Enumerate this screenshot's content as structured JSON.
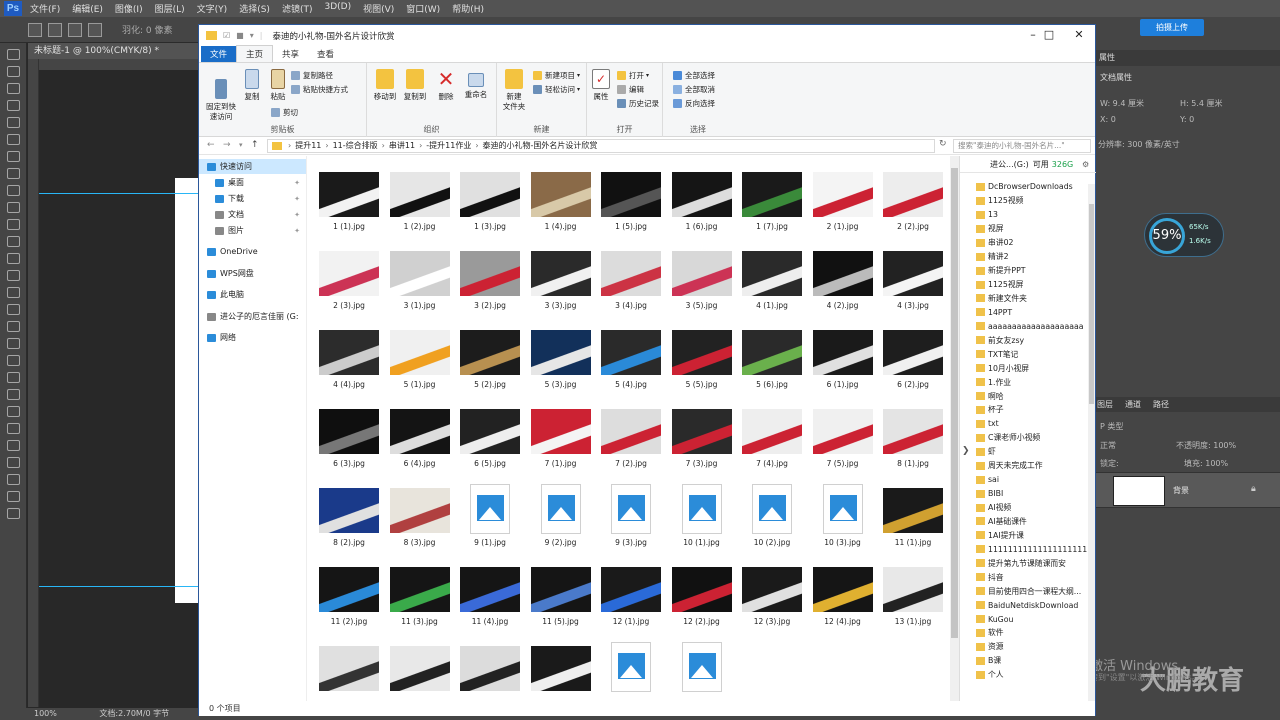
{
  "photoshop": {
    "logo": "Ps",
    "menu": [
      "文件(F)",
      "编辑(E)",
      "图像(I)",
      "图层(L)",
      "文字(Y)",
      "选择(S)",
      "滤镜(T)",
      "3D(D)",
      "视图(V)",
      "窗口(W)",
      "帮助(H)"
    ],
    "options_text": "羽化: 0 像素",
    "doc_tab": "未标题-1 @ 100%(CMYK/8) *",
    "status_zoom": "100%",
    "status_doc": "文档:2.70M/0 字节",
    "cloud_button": "拍摄上传",
    "properties_tab": "属性",
    "properties_title": "文档属性",
    "prop_w": "W: 9.4 厘米",
    "prop_h": "H: 5.4 厘米",
    "prop_x": "X: 0",
    "prop_y": "Y: 0",
    "prop_res": "分辨率: 300 像素/英寸",
    "speed_pct": "59%",
    "speed_up": "65K/s",
    "speed_down": "1.6K/s",
    "layers_tabs": [
      "图层",
      "通道",
      "路径"
    ],
    "layers_filter": "P 类型",
    "layers_mode": "正常",
    "layers_opacity": "不透明度: 100%",
    "layers_lock": "锁定:",
    "layers_fill": "填充: 100%",
    "layer_name": "背景",
    "watermark": "大鹏教育",
    "activate_line1": "激活 Windows",
    "activate_line2": "转到\"设置\"以激活 Windows。"
  },
  "explorer": {
    "title": "泰迪的小礼物-国外名片设计欣赏",
    "tabs": [
      "文件",
      "主页",
      "共享",
      "查看"
    ],
    "ribbon": {
      "pin": "固定到快\n速访问",
      "copy": "复制",
      "paste": "粘贴",
      "copy_path": "复制路径",
      "paste_shortcut": "粘贴快捷方式",
      "cut": "剪切",
      "clipboard": "剪贴板",
      "move_to": "移动到",
      "copy_to": "复制到",
      "delete": "删除",
      "rename": "重命名",
      "organize": "组织",
      "new_folder": "新建\n文件夹",
      "new_item": "新建项目",
      "easy_access": "轻松访问",
      "new": "新建",
      "properties": "属性",
      "open": "打开",
      "edit": "编辑",
      "history": "历史记录",
      "open_group": "打开",
      "select_all": "全部选择",
      "select_none": "全部取消",
      "invert": "反向选择",
      "select_group": "选择"
    },
    "breadcrumb": [
      "提升11",
      "11-综合排版",
      "串讲11",
      "-提升11作业",
      "泰迪的小礼物-国外名片设计欣赏"
    ],
    "search_placeholder": "搜索\"泰迪的小礼物-国外名片...\"",
    "nav": [
      {
        "label": "快速访问",
        "color": "#2b8cd9"
      },
      {
        "label": "桌面",
        "color": "#2b8cd9"
      },
      {
        "label": "下载",
        "color": "#2b8cd9"
      },
      {
        "label": "文档",
        "color": "#888888"
      },
      {
        "label": "图片",
        "color": "#888888"
      },
      {
        "label": "OneDrive",
        "color": "#2b8cd9"
      },
      {
        "label": "WPS网盘",
        "color": "#2b8cd9"
      },
      {
        "label": "此电脑",
        "color": "#2b8cd9"
      },
      {
        "label": "进公子的厄言佳丽 (G:",
        "color": "#888888"
      },
      {
        "label": "网络",
        "color": "#2b8cd9"
      }
    ],
    "files": [
      {
        "name": "1 (1).jpg",
        "c": "#1a1a1a",
        "c2": "#f2f2f2"
      },
      {
        "name": "1 (2).jpg",
        "c": "#e6e6e6",
        "c2": "#111111"
      },
      {
        "name": "1 (3).jpg",
        "c": "#e0e0e0",
        "c2": "#111111"
      },
      {
        "name": "1 (4).jpg",
        "c": "#8a6a48",
        "c2": "#d8c9a8"
      },
      {
        "name": "1 (5).jpg",
        "c": "#111111",
        "c2": "#555555"
      },
      {
        "name": "1 (6).jpg",
        "c": "#151515",
        "c2": "#dddddd"
      },
      {
        "name": "1 (7).jpg",
        "c": "#1a1a1a",
        "c2": "#3a8a3a"
      },
      {
        "name": "2 (1).jpg",
        "c": "#f4f4f4",
        "c2": "#cc2233"
      },
      {
        "name": "2 (2).jpg",
        "c": "#ededed",
        "c2": "#cc2233"
      },
      {
        "name": "2 (3).jpg",
        "c": "#f2f2f2",
        "c2": "#cc3355"
      },
      {
        "name": "3 (1).jpg",
        "c": "#d0d0d0",
        "c2": "#ffffff"
      },
      {
        "name": "3 (2).jpg",
        "c": "#9a9a9a",
        "c2": "#cc2233"
      },
      {
        "name": "3 (3).jpg",
        "c": "#2a2a2a",
        "c2": "#f0f0f0"
      },
      {
        "name": "3 (4).jpg",
        "c": "#dcdcdc",
        "c2": "#cc3344"
      },
      {
        "name": "3 (5).jpg",
        "c": "#d8d8d8",
        "c2": "#cc3355"
      },
      {
        "name": "4 (1).jpg",
        "c": "#2a2a2a",
        "c2": "#eeeeee"
      },
      {
        "name": "4 (2).jpg",
        "c": "#111111",
        "c2": "#bbbbbb"
      },
      {
        "name": "4 (3).jpg",
        "c": "#222222",
        "c2": "#f4f4f4"
      },
      {
        "name": "4 (4).jpg",
        "c": "#2c2c2c",
        "c2": "#cccccc"
      },
      {
        "name": "5 (1).jpg",
        "c": "#f0f0f0",
        "c2": "#f0a020"
      },
      {
        "name": "5 (2).jpg",
        "c": "#1c1c1c",
        "c2": "#b89050"
      },
      {
        "name": "5 (3).jpg",
        "c": "#12305a",
        "c2": "#e6e6e6"
      },
      {
        "name": "5 (4).jpg",
        "c": "#2a2a2a",
        "c2": "#2a8ad8"
      },
      {
        "name": "5 (5).jpg",
        "c": "#222222",
        "c2": "#cc2233"
      },
      {
        "name": "5 (6).jpg",
        "c": "#2a2a2a",
        "c2": "#6ab04c"
      },
      {
        "name": "6 (1).jpg",
        "c": "#1a1a1a",
        "c2": "#e0e0e0"
      },
      {
        "name": "6 (2).jpg",
        "c": "#1e1e1e",
        "c2": "#f0f0f0"
      },
      {
        "name": "6 (3).jpg",
        "c": "#0f0f0f",
        "c2": "#777777"
      },
      {
        "name": "6 (4).jpg",
        "c": "#141414",
        "c2": "#dddddd"
      },
      {
        "name": "6 (5).jpg",
        "c": "#222222",
        "c2": "#eeeeee"
      },
      {
        "name": "7 (1).jpg",
        "c": "#cc2233",
        "c2": "#f4f4f4"
      },
      {
        "name": "7 (2).jpg",
        "c": "#dddddd",
        "c2": "#cc2233"
      },
      {
        "name": "7 (3).jpg",
        "c": "#2a2a2a",
        "c2": "#cc2233"
      },
      {
        "name": "7 (4).jpg",
        "c": "#eeeeee",
        "c2": "#cc2233"
      },
      {
        "name": "7 (5).jpg",
        "c": "#f0f0f0",
        "c2": "#cc2233"
      },
      {
        "name": "8 (1).jpg",
        "c": "#e4e4e4",
        "c2": "#cc2233"
      },
      {
        "name": "8 (2).jpg",
        "c": "#1a3a8a",
        "c2": "#e0e0e0"
      },
      {
        "name": "8 (3).jpg",
        "c": "#e8e4dc",
        "c2": "#b04040"
      },
      {
        "name": "9 (1).jpg",
        "ph": true
      },
      {
        "name": "9 (2).jpg",
        "ph": true
      },
      {
        "name": "9 (3).jpg",
        "ph": true
      },
      {
        "name": "10 (1).jpg",
        "ph": true
      },
      {
        "name": "10 (2).jpg",
        "ph": true
      },
      {
        "name": "10 (3).jpg",
        "ph": true
      },
      {
        "name": "11 (1).jpg",
        "c": "#1a1a1a",
        "c2": "#d0a030"
      },
      {
        "name": "11 (2).jpg",
        "c": "#151515",
        "c2": "#2a8ad8"
      },
      {
        "name": "11 (3).jpg",
        "c": "#151515",
        "c2": "#3aaa4a"
      },
      {
        "name": "11 (4).jpg",
        "c": "#151515",
        "c2": "#3a6ad8"
      },
      {
        "name": "11 (5).jpg",
        "c": "#151515",
        "c2": "#4a7aca"
      },
      {
        "name": "12 (1).jpg",
        "c": "#1a1a1a",
        "c2": "#2a6ad8"
      },
      {
        "name": "12 (2).jpg",
        "c": "#111111",
        "c2": "#cc2233"
      },
      {
        "name": "12 (3).jpg",
        "c": "#1a1a1a",
        "c2": "#e0e0e0"
      },
      {
        "name": "12 (4).jpg",
        "c": "#151515",
        "c2": "#e0b030"
      },
      {
        "name": "13 (1).jpg",
        "c": "#e8e8e8",
        "c2": "#222222"
      },
      {
        "name": "",
        "c": "#e0e0e0",
        "c2": "#333333"
      },
      {
        "name": "",
        "c": "#e8e8e8",
        "c2": "#222222"
      },
      {
        "name": "",
        "c": "#dcdcdc",
        "c2": "#222222"
      },
      {
        "name": "",
        "c": "#1a1a1a",
        "c2": "#eeeeee"
      },
      {
        "name": "",
        "ph": true
      },
      {
        "name": "",
        "ph": true
      }
    ],
    "status": "0 个项目",
    "side_header_drive": "进公...(G:)",
    "side_header_free_label": "可用",
    "side_header_free": "326G",
    "side_folders": [
      "DcBrowserDownloads",
      "1125视频",
      "13",
      "视屏",
      "串讲02",
      "精讲2",
      "新提升PPT",
      "1125视屏",
      "新建文件夹",
      "14PPT",
      "aaaaaaaaaaaaaaaaaaaa",
      "前女友zsy",
      "TXT笔记",
      "10月小视屏",
      "1.作业",
      "啊哈",
      "杯子",
      "txt",
      "C课老师小视频",
      "虾",
      "周天未完成工作",
      "sai",
      "BIBI",
      "AI视频",
      "AI基础课件",
      "1AI提升课",
      "11111111111111111111.",
      "提升第九节课随课而安",
      "抖音",
      "目前使用四合一课程大纲...",
      "BaiduNetdiskDownload",
      "KuGou",
      "软件",
      "资源",
      "B课",
      "个人"
    ]
  }
}
